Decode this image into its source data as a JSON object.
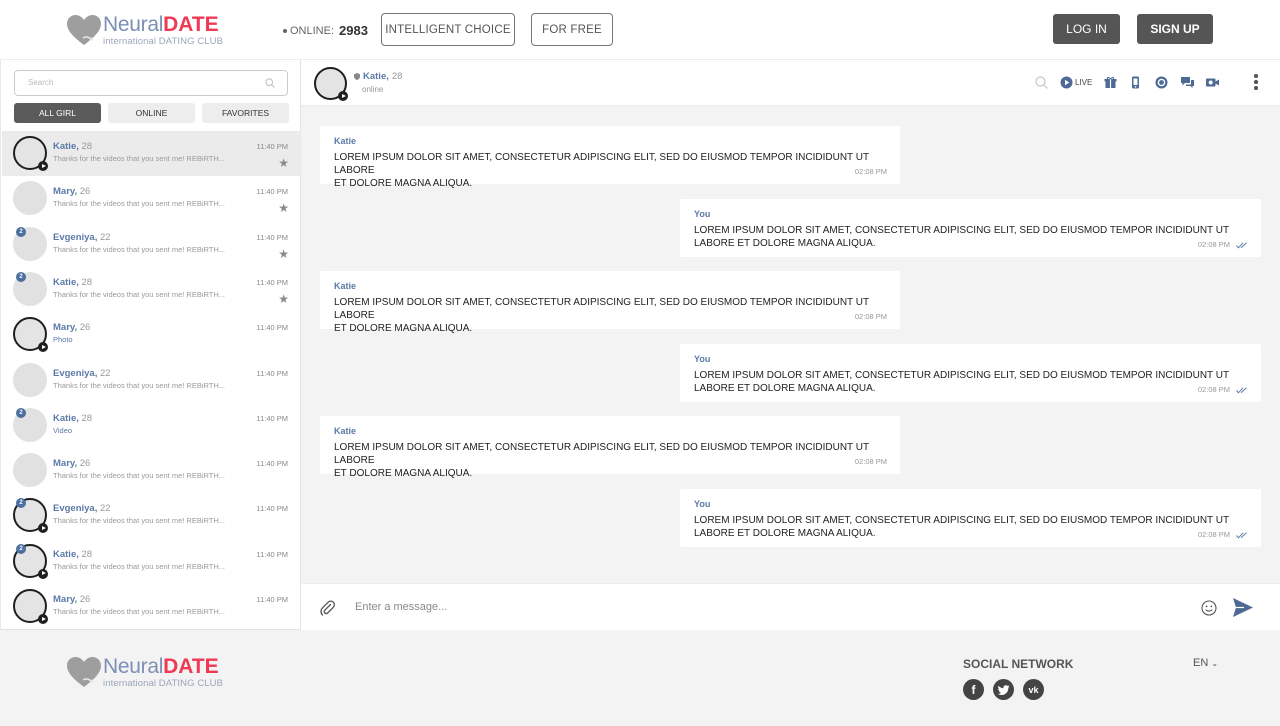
{
  "brand": {
    "name_light": "Neural",
    "name_bold": "DATE",
    "tagline": "international DATING CLUB"
  },
  "header": {
    "online_label": "ONLINE:",
    "online_count": "2983",
    "intelligent_choice": "INTELLIGENT CHOICE",
    "for_free": "FOR FREE",
    "login": "LOG IN",
    "signup": "SIGN UP"
  },
  "sidebar": {
    "search_placeholder": "Search",
    "filters": [
      "ALL GIRL",
      "ONLINE",
      "FAVORITES"
    ],
    "contacts": [
      {
        "name": "Katie,",
        "age": "28",
        "message": "Thanks for the videos that you sent me! REBiRTH...",
        "time": "11:40 PM",
        "star": true,
        "live": true,
        "badge": "",
        "active": true,
        "media": false
      },
      {
        "name": "Mary,",
        "age": "26",
        "message": "Thanks for the videos that you sent me! REBiRTH...",
        "time": "11:40 PM",
        "star": true,
        "live": false,
        "badge": "",
        "active": false,
        "media": false
      },
      {
        "name": "Evgeniya,",
        "age": "22",
        "message": "Thanks for the videos that you sent me! REBiRTH...",
        "time": "11:40 PM",
        "star": true,
        "live": false,
        "badge": "2",
        "active": false,
        "media": false
      },
      {
        "name": "Katie,",
        "age": "28",
        "message": "Thanks for the videos that you sent me! REBiRTH...",
        "time": "11:40 PM",
        "star": true,
        "live": false,
        "badge": "2",
        "active": false,
        "media": false
      },
      {
        "name": "Mary,",
        "age": "26",
        "message": "Photo",
        "time": "11:40 PM",
        "star": false,
        "live": true,
        "badge": "",
        "active": false,
        "media": true
      },
      {
        "name": "Evgeniya,",
        "age": "22",
        "message": "Thanks for the videos that you sent me! REBiRTH...",
        "time": "11:40 PM",
        "star": false,
        "live": false,
        "badge": "",
        "active": false,
        "media": false
      },
      {
        "name": "Katie,",
        "age": "28",
        "message": "Video",
        "time": "11:40 PM",
        "star": false,
        "live": false,
        "badge": "2",
        "active": false,
        "media": true
      },
      {
        "name": "Mary,",
        "age": "26",
        "message": "Thanks for the videos that you sent me! REBiRTH...",
        "time": "11:40 PM",
        "star": false,
        "live": false,
        "badge": "",
        "active": false,
        "media": false
      },
      {
        "name": "Evgeniya,",
        "age": "22",
        "message": "Thanks for the videos that you sent me! REBiRTH...",
        "time": "11:40 PM",
        "star": false,
        "live": true,
        "badge": "2",
        "active": false,
        "media": false
      },
      {
        "name": "Katie,",
        "age": "28",
        "message": "Thanks for the videos that you sent me! REBiRTH...",
        "time": "11:40 PM",
        "star": false,
        "live": true,
        "badge": "2",
        "active": false,
        "media": false
      },
      {
        "name": "Mary,",
        "age": "26",
        "message": "Thanks for the videos that you sent me! REBiRTH...",
        "time": "11:40 PM",
        "star": false,
        "live": true,
        "badge": "",
        "active": false,
        "media": false
      }
    ]
  },
  "chat": {
    "partner": {
      "name": "Katie,",
      "age": "28",
      "status": "online"
    },
    "live_label": "LIVE",
    "messages": [
      {
        "author": "Katie",
        "line1": "Lorem ipsum dolor sit amet, consectetur adipiscing elit, sed do eiusmod tempor incididunt ut labore",
        "line2": "et dolore magna aliqua.",
        "time": "02:08 PM",
        "mine": false
      },
      {
        "author": "You",
        "line1": "Lorem ipsum dolor sit amet, consectetur adipiscing elit, sed do eiusmod tempor incididunt ut",
        "line2": "labore et dolore magna aliqua.",
        "time": "02:08 PM",
        "mine": true
      },
      {
        "author": "Katie",
        "line1": "Lorem ipsum dolor sit amet, consectetur adipiscing elit, sed do eiusmod tempor incididunt ut labore",
        "line2": "et dolore magna aliqua.",
        "time": "02:08 PM",
        "mine": false
      },
      {
        "author": "You",
        "line1": "Lorem ipsum dolor sit amet, consectetur adipiscing elit, sed do eiusmod tempor incididunt ut",
        "line2": "labore et dolore magna aliqua.",
        "time": "02:08 PM",
        "mine": true
      },
      {
        "author": "Katie",
        "line1": "Lorem ipsum dolor sit amet, consectetur adipiscing elit, sed do eiusmod tempor incididunt ut labore",
        "line2": "et dolore magna aliqua.",
        "time": "02:08 PM",
        "mine": false
      },
      {
        "author": "You",
        "line1": "Lorem ipsum dolor sit amet, consectetur adipiscing elit, sed do eiusmod tempor incididunt ut",
        "line2": "labore et dolore magna aliqua.",
        "time": "02:08 PM",
        "mine": true
      }
    ],
    "composer_placeholder": "Enter a message..."
  },
  "footer": {
    "social_title": "SOCIAL NETWORK",
    "social": [
      "facebook-icon",
      "twitter-icon",
      "vk-icon"
    ],
    "language": "EN"
  },
  "colors": {
    "accent_blue": "#5b7aa8",
    "brand_red": "#ee3a55",
    "dark_button": "#555555"
  }
}
